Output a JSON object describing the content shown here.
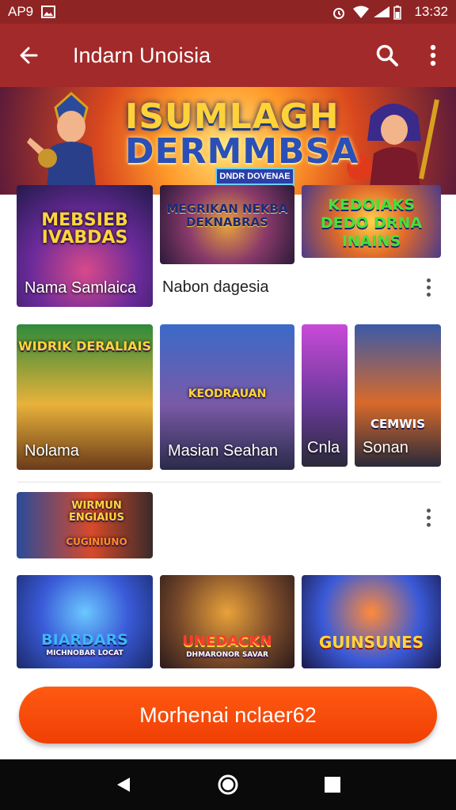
{
  "status_bar": {
    "carrier": "AP9",
    "time": "13:32"
  },
  "app_bar": {
    "title": "Indarn Unoisia"
  },
  "banner": {
    "title_line1": "ISUMLAGH",
    "title_line2": "DERMMBSA",
    "tag": "DNDR DOVENAE"
  },
  "section1": {
    "cards": [
      {
        "art_title": "MEBSIEB IVABDAS",
        "caption": "Nama Samlaica"
      },
      {
        "art_title": "MEGRIKAN NEKBA DEKNABRAS",
        "caption": ""
      },
      {
        "art_title": "KEDOIAKS DEDO DRNA INAINS",
        "caption": ""
      }
    ],
    "row_label": "Nabon dagesia"
  },
  "section2": {
    "cards": [
      {
        "art_title": "WIDRIK DERALIAIS",
        "caption": "Nolama"
      },
      {
        "art_title": "KEODRAUAN",
        "caption": "Masian Seahan"
      },
      {
        "art_title": "",
        "caption": "Cnla"
      },
      {
        "art_title": "CEMWIS",
        "caption": "Sonan"
      }
    ]
  },
  "section3": {
    "feature": {
      "art_title": "WIRMUN ENGIAIUS",
      "subtitle": "CUGINIUNO"
    },
    "cards": [
      {
        "art_title": "BIARDARS",
        "subtitle": "MICHNOBAR LOCAT"
      },
      {
        "art_title": "UNEDACKN",
        "subtitle": "DHMARONOR SAVAR"
      },
      {
        "art_title": "GUINSUNES",
        "subtitle": ""
      }
    ]
  },
  "cta": {
    "label": "Morhenai nclaer62"
  },
  "colors": {
    "app_bar": "#a32a2a",
    "status_bar": "#8f2424",
    "cta": "#f64a0a",
    "nav_bar": "#0a0a0a"
  }
}
